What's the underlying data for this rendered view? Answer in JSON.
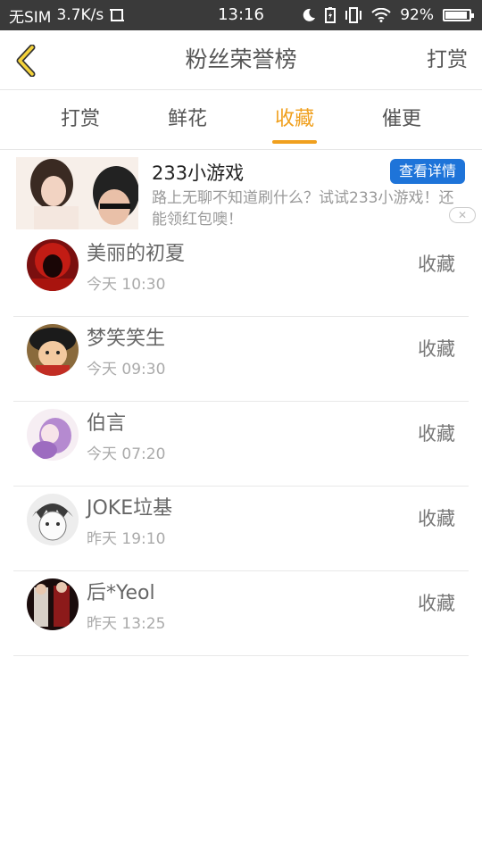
{
  "status_bar": {
    "carrier": "无SIM",
    "speed": "3.7K/s",
    "time": "13:16",
    "battery": "92%",
    "battery_level": 0.92
  },
  "header": {
    "title": "粉丝荣誉榜",
    "action": "打赏"
  },
  "tabs": [
    {
      "label": "打赏",
      "active": false
    },
    {
      "label": "鲜花",
      "active": false
    },
    {
      "label": "收藏",
      "active": true
    },
    {
      "label": "催更",
      "active": false
    }
  ],
  "ad": {
    "title": "233小游戏",
    "description": "路上无聊不知道刷什么？试试233小游戏！还能领红包噢！",
    "cta": "查看详情"
  },
  "list": [
    {
      "name": "美丽的初夏",
      "time": "今天 10:30",
      "action": "收藏"
    },
    {
      "name": "梦笑笑生",
      "time": "今天 09:30",
      "action": "收藏"
    },
    {
      "name": "伯言",
      "time": "今天 07:20",
      "action": "收藏"
    },
    {
      "name": "JOKE垃基",
      "time": "昨天 19:10",
      "action": "收藏"
    },
    {
      "name": "后*Yeol",
      "time": "昨天 13:25",
      "action": "收藏"
    }
  ],
  "colors": {
    "accent": "#f0a01e",
    "ad_button": "#1e74d9",
    "status_bar": "#3a3a3a"
  }
}
